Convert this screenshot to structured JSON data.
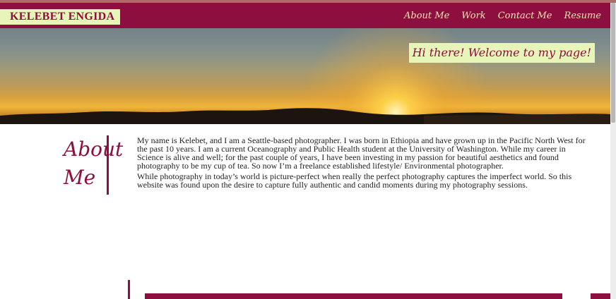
{
  "header": {
    "brand": "KELEBET ENGIDA",
    "nav": [
      "About Me",
      "Work",
      "Contact Me",
      "Resume"
    ]
  },
  "hero": {
    "greeting": "Hi there! Welcome to my page!"
  },
  "about": {
    "title_line1": "About",
    "title_line2": "Me",
    "paragraphs": [
      "My name is Kelebet, and I am a Seattle-based photographer. I was born in Ethiopia and have grown up in the Pacific North West for the past 10 years. I am a current Oceanography and Public Health student at the University of Washington. While my career in Science is alive and well; for the past couple of years, I have been investing in my passion for beautiful aesthetics and found photography to be my cup of tea. So now I’m a freelance established lifestyle/ Environmental photographer.",
      "While photography in today’s world is picture-perfect when really the perfect photography captures the imperfect world. So this website was found upon the desire to capture fully authentic and candid moments during my photography sessions."
    ]
  },
  "colors": {
    "accent": "#8c0f3f",
    "highlight": "#e8f5b8",
    "nav_text": "#f3e6b0"
  }
}
